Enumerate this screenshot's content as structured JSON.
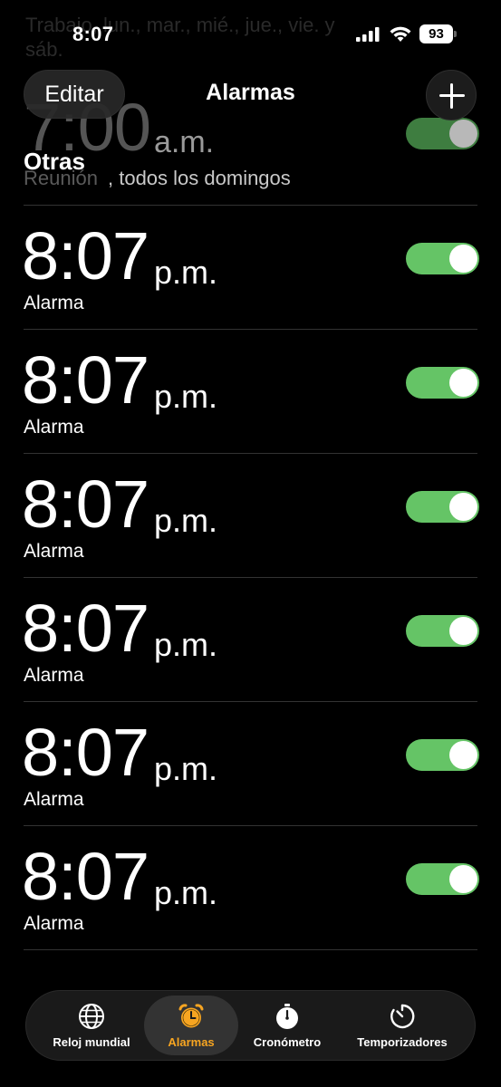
{
  "status_bar": {
    "time": "8:07",
    "battery": "93"
  },
  "background_text": "Trabajo, lun., mar., mié., jue., vie. y sáb.",
  "header": {
    "edit_label": "Editar",
    "title": "Alarmas",
    "add_icon": "plus-icon"
  },
  "first_alarm": {
    "time": "7:00",
    "ampm": "a.m.",
    "label": "Reunión",
    "repeat": ", todos los domingos",
    "enabled": true
  },
  "section_title": "Otras",
  "alarms": [
    {
      "time": "8:07",
      "ampm": "p.m.",
      "label": "Alarma",
      "enabled": true
    },
    {
      "time": "8:07",
      "ampm": "p.m.",
      "label": "Alarma",
      "enabled": true
    },
    {
      "time": "8:07",
      "ampm": "p.m.",
      "label": "Alarma",
      "enabled": true
    },
    {
      "time": "8:07",
      "ampm": "p.m.",
      "label": "Alarma",
      "enabled": true
    },
    {
      "time": "8:07",
      "ampm": "p.m.",
      "label": "Alarma",
      "enabled": true
    },
    {
      "time": "8:07",
      "ampm": "p.m.",
      "label": "Alarma",
      "enabled": true
    }
  ],
  "tabs": [
    {
      "label": "Reloj mundial",
      "icon": "globe-icon",
      "active": false
    },
    {
      "label": "Alarmas",
      "icon": "alarm-clock-icon",
      "active": true
    },
    {
      "label": "Cronómetro",
      "icon": "stopwatch-icon",
      "active": false
    },
    {
      "label": "Temporizadores",
      "icon": "timer-icon",
      "active": false
    }
  ],
  "colors": {
    "background": "#000000",
    "toggle_on": "#65c466",
    "accent": "#f7a521"
  }
}
